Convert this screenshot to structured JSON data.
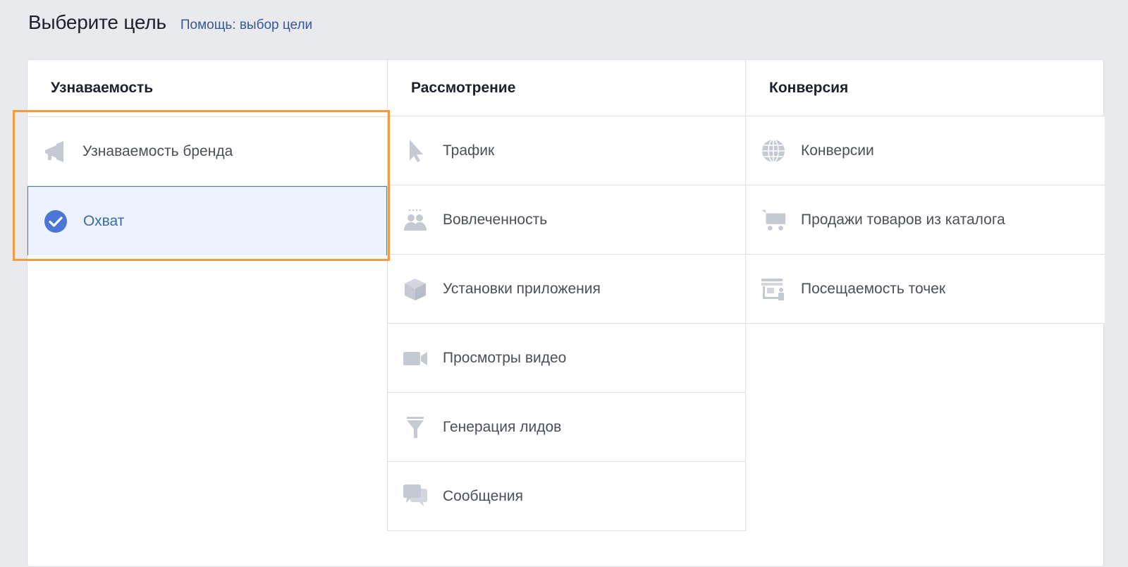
{
  "header": {
    "title": "Выберите цель",
    "help_link": "Помощь: выбор цели"
  },
  "columns": [
    {
      "title": "Узнаваемость",
      "items": [
        {
          "label": "Узнаваемость бренда",
          "icon": "megaphone-icon",
          "selected": false
        },
        {
          "label": "Охват",
          "icon": "check-circle-icon",
          "selected": true
        }
      ]
    },
    {
      "title": "Рассмотрение",
      "items": [
        {
          "label": "Трафик",
          "icon": "cursor-icon",
          "selected": false
        },
        {
          "label": "Вовлеченность",
          "icon": "people-icon",
          "selected": false
        },
        {
          "label": "Установки приложения",
          "icon": "box-icon",
          "selected": false
        },
        {
          "label": "Просмотры видео",
          "icon": "video-camera-icon",
          "selected": false
        },
        {
          "label": "Генерация лидов",
          "icon": "funnel-icon",
          "selected": false
        },
        {
          "label": "Сообщения",
          "icon": "chat-bubbles-icon",
          "selected": false
        }
      ]
    },
    {
      "title": "Конверсия",
      "items": [
        {
          "label": "Конверсии",
          "icon": "globe-icon",
          "selected": false
        },
        {
          "label": "Продажи товаров из каталога",
          "icon": "cart-icon",
          "selected": false
        },
        {
          "label": "Посещаемость точек",
          "icon": "store-icon",
          "selected": false
        }
      ]
    }
  ],
  "colors": {
    "accent": "#4a76d6",
    "highlight": "#f49b42",
    "icon_gray": "#c5c9d3",
    "selected_bg": "#ecf3ff"
  }
}
